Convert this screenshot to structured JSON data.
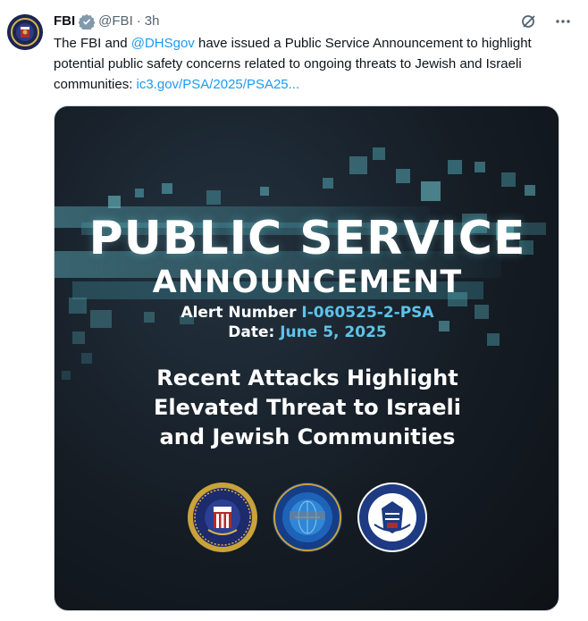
{
  "tweet": {
    "display_name": "FBI",
    "handle": "@FBI",
    "separator": "·",
    "time": "3h",
    "icons": {
      "verified": "verified-badge-icon",
      "grok": "grok-icon",
      "more": "more-icon",
      "avatar": "fbi-seal-avatar"
    },
    "text": {
      "part1": "The FBI and ",
      "mention": "@DHSgov",
      "part2": " have issued a Public Service Announcement to highlight potential public safety concerns related to ongoing threats to Jewish and Israeli communities: ",
      "link": "ic3.gov/PSA/2025/PSA25..."
    },
    "colors": {
      "link": "#1d9bf0",
      "muted": "#536471",
      "accent": "#5ec3e8"
    }
  },
  "media": {
    "title_line1": "PUBLIC SERVICE",
    "title_line2": "ANNOUNCEMENT",
    "alert_label": "Alert Number ",
    "alert_value": "I-060525-2-PSA",
    "date_label": "Date: ",
    "date_value": "June 5, 2025",
    "headline_1": "Recent Attacks Highlight",
    "headline_2": "Elevated Threat to Israeli",
    "headline_3": "and Jewish Communities",
    "seals": [
      "fbi-seal",
      "ic3-seal",
      "dhs-seal"
    ]
  }
}
